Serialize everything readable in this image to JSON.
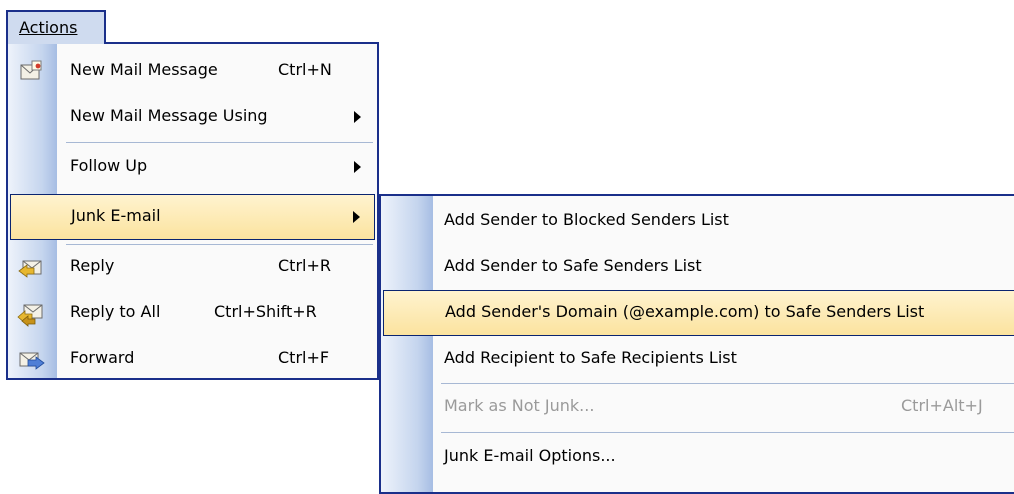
{
  "menu_bar": {
    "actions_label": "Actions"
  },
  "actions_menu": {
    "new_mail": {
      "label": "New Mail Message",
      "shortcut": "Ctrl+N"
    },
    "new_mail_using": {
      "label": "New Mail Message Using"
    },
    "follow_up": {
      "label": "Follow Up"
    },
    "junk_email": {
      "label": "Junk E-mail"
    },
    "reply": {
      "label": "Reply",
      "shortcut": "Ctrl+R"
    },
    "reply_all": {
      "label": "Reply to All",
      "shortcut": "Ctrl+Shift+R"
    },
    "forward": {
      "label": "Forward",
      "shortcut": "Ctrl+F"
    }
  },
  "junk_submenu": {
    "blocked": {
      "label": "Add Sender to Blocked Senders List"
    },
    "safe_sender": {
      "label": "Add Sender to Safe Senders List"
    },
    "safe_domain": {
      "label": "Add Sender's Domain (@example.com) to Safe Senders List"
    },
    "safe_recipient": {
      "label": "Add Recipient to Safe Recipients List"
    },
    "not_junk": {
      "label": "Mark as Not Junk...",
      "shortcut": "Ctrl+Alt+J"
    },
    "options": {
      "label": "Junk E-mail Options..."
    }
  },
  "colors": {
    "menu_border": "#1a2f8a",
    "highlight": "#fbe39f",
    "gutter": "#c5d5ee",
    "disabled_text": "#9a9a9a"
  },
  "icons": [
    "new-mail-icon",
    "reply-icon",
    "reply-all-icon",
    "forward-icon",
    "submenu-arrow-icon"
  ]
}
